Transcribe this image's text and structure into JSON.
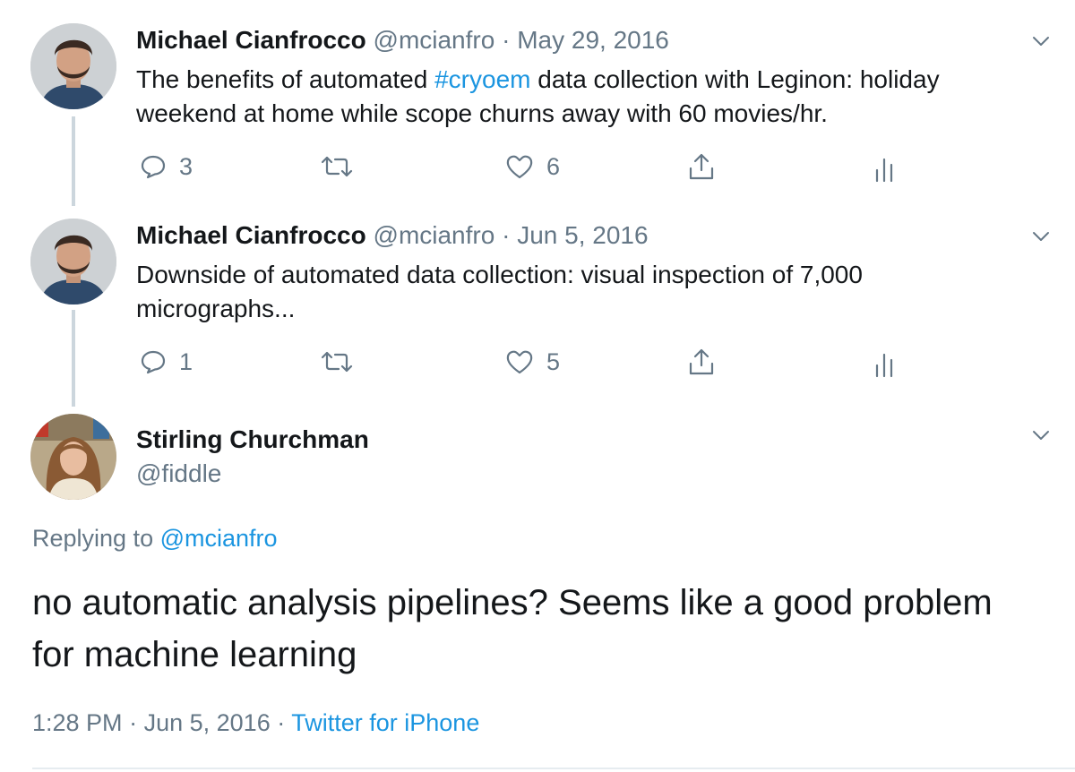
{
  "tweets": [
    {
      "author_name": "Michael Cianfrocco",
      "handle": "@mcianfro",
      "separator": "·",
      "date": "May 29, 2016",
      "text_before": "The benefits of automated ",
      "hashtag": "#cryoem",
      "text_after": " data collection with Leginon: holiday weekend at home while scope churns away with 60 movies/hr.",
      "reply_count": "3",
      "retweet_count": "",
      "like_count": "6"
    },
    {
      "author_name": "Michael Cianfrocco",
      "handle": "@mcianfro",
      "separator": "·",
      "date": "Jun 5, 2016",
      "text": "Downside of automated data collection: visual inspection of 7,000 micrographs...",
      "reply_count": "1",
      "retweet_count": "",
      "like_count": "5"
    }
  ],
  "main_tweet": {
    "author_name": "Stirling Churchman",
    "handle": "@fiddle",
    "replying_prefix": "Replying to ",
    "replying_to": "@mcianfro",
    "text": "no automatic analysis pipelines? Seems like a good problem for machine learning",
    "time": "1:28 PM",
    "separator": "·",
    "date": "Jun 5, 2016",
    "source": "Twitter for iPhone"
  },
  "icons": {
    "reply": "reply-icon",
    "retweet": "retweet-icon",
    "like": "heart-icon",
    "share": "share-icon",
    "analytics": "analytics-icon",
    "more": "chevron-down-icon"
  },
  "colors": {
    "link": "#1b95e0",
    "secondary_text": "#657786",
    "primary_text": "#14171a",
    "thread_line": "#ccd6dd"
  }
}
